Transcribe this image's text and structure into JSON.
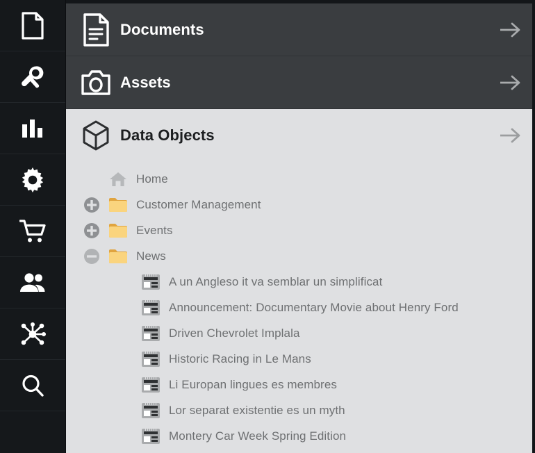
{
  "colors": {
    "rail_bg": "#15181b",
    "panel_dark": "#3a3d40",
    "panel_light": "#dfe0e2",
    "folder": "#f7ce6b",
    "label_text": "#6e7072"
  },
  "rail": {
    "items": [
      {
        "name": "document-icon",
        "label": "Documents"
      },
      {
        "name": "wrench-icon",
        "label": "Tools"
      },
      {
        "name": "bar-chart-icon",
        "label": "Reports"
      },
      {
        "name": "gear-icon",
        "label": "Settings"
      },
      {
        "name": "shopping-cart-icon",
        "label": "Commerce"
      },
      {
        "name": "users-icon",
        "label": "Customers"
      },
      {
        "name": "network-hub-icon",
        "label": "Data Hub"
      },
      {
        "name": "search-icon",
        "label": "Search"
      }
    ]
  },
  "sections": [
    {
      "title": "Documents",
      "icon": "document-lines-icon",
      "theme": "dark",
      "arrow": "arrow-right-icon"
    },
    {
      "title": "Assets",
      "icon": "camera-icon",
      "theme": "dark",
      "arrow": "arrow-right-icon"
    },
    {
      "title": "Data Objects",
      "icon": "cube-icon",
      "theme": "light",
      "arrow": "arrow-right-icon"
    }
  ],
  "tree": {
    "root": {
      "label": "Home",
      "icon": "home-icon"
    },
    "folders": [
      {
        "label": "Customer Management",
        "toggle": "plus",
        "icon": "folder-icon"
      },
      {
        "label": "Events",
        "toggle": "plus",
        "icon": "folder-icon"
      },
      {
        "label": "News",
        "toggle": "minus",
        "icon": "folder-icon"
      }
    ],
    "objects": [
      {
        "label": "A un Angleso it va semblar un simplificat",
        "icon": "data-object-icon"
      },
      {
        "label": "Announcement: Documentary Movie about Henry Ford",
        "icon": "data-object-icon"
      },
      {
        "label": "Driven Chevrolet Implala",
        "icon": "data-object-icon"
      },
      {
        "label": "Historic Racing in Le Mans",
        "icon": "data-object-icon"
      },
      {
        "label": "Li Europan lingues es membres",
        "icon": "data-object-icon"
      },
      {
        "label": "Lor separat existentie es un myth",
        "icon": "data-object-icon"
      },
      {
        "label": "Montery Car Week Spring Edition",
        "icon": "data-object-icon"
      }
    ]
  }
}
